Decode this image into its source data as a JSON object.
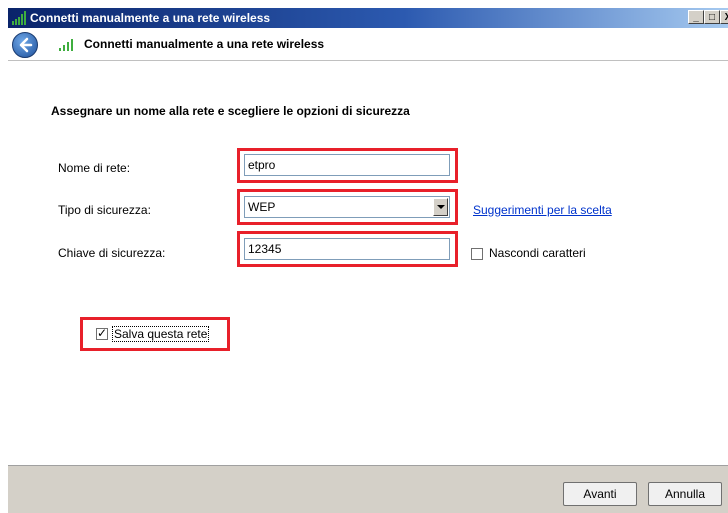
{
  "window": {
    "title": "Connetti manualmente a una rete wireless",
    "minimize_glyph": "_",
    "maximize_glyph": "□",
    "close_glyph": "X"
  },
  "nav": {
    "title": "Connetti manualmente a una rete wireless"
  },
  "form": {
    "heading": "Assegnare un nome alla rete e scegliere le opzioni di sicurezza",
    "network_name_label": "Nome di rete:",
    "network_name_value": "etpro",
    "security_type_label": "Tipo di sicurezza:",
    "security_type_value": "WEP",
    "security_help_link": "Suggerimenti per la scelta",
    "security_key_label": "Chiave di sicurezza:",
    "security_key_value": "12345",
    "hide_chars_label": "Nascondi caratteri",
    "hide_chars_checked": false,
    "save_network_label": "Salva questa rete",
    "save_network_checked": true
  },
  "footer": {
    "next_label": "Avanti",
    "cancel_label": "Annulla"
  },
  "colors": {
    "highlight": "#e8202a",
    "link": "#0033cc",
    "title_bar": "#0a246a"
  },
  "icons": [
    "wireless-signal-icon",
    "back-arrow-icon",
    "dropdown-arrow-icon",
    "checkmark-icon"
  ]
}
